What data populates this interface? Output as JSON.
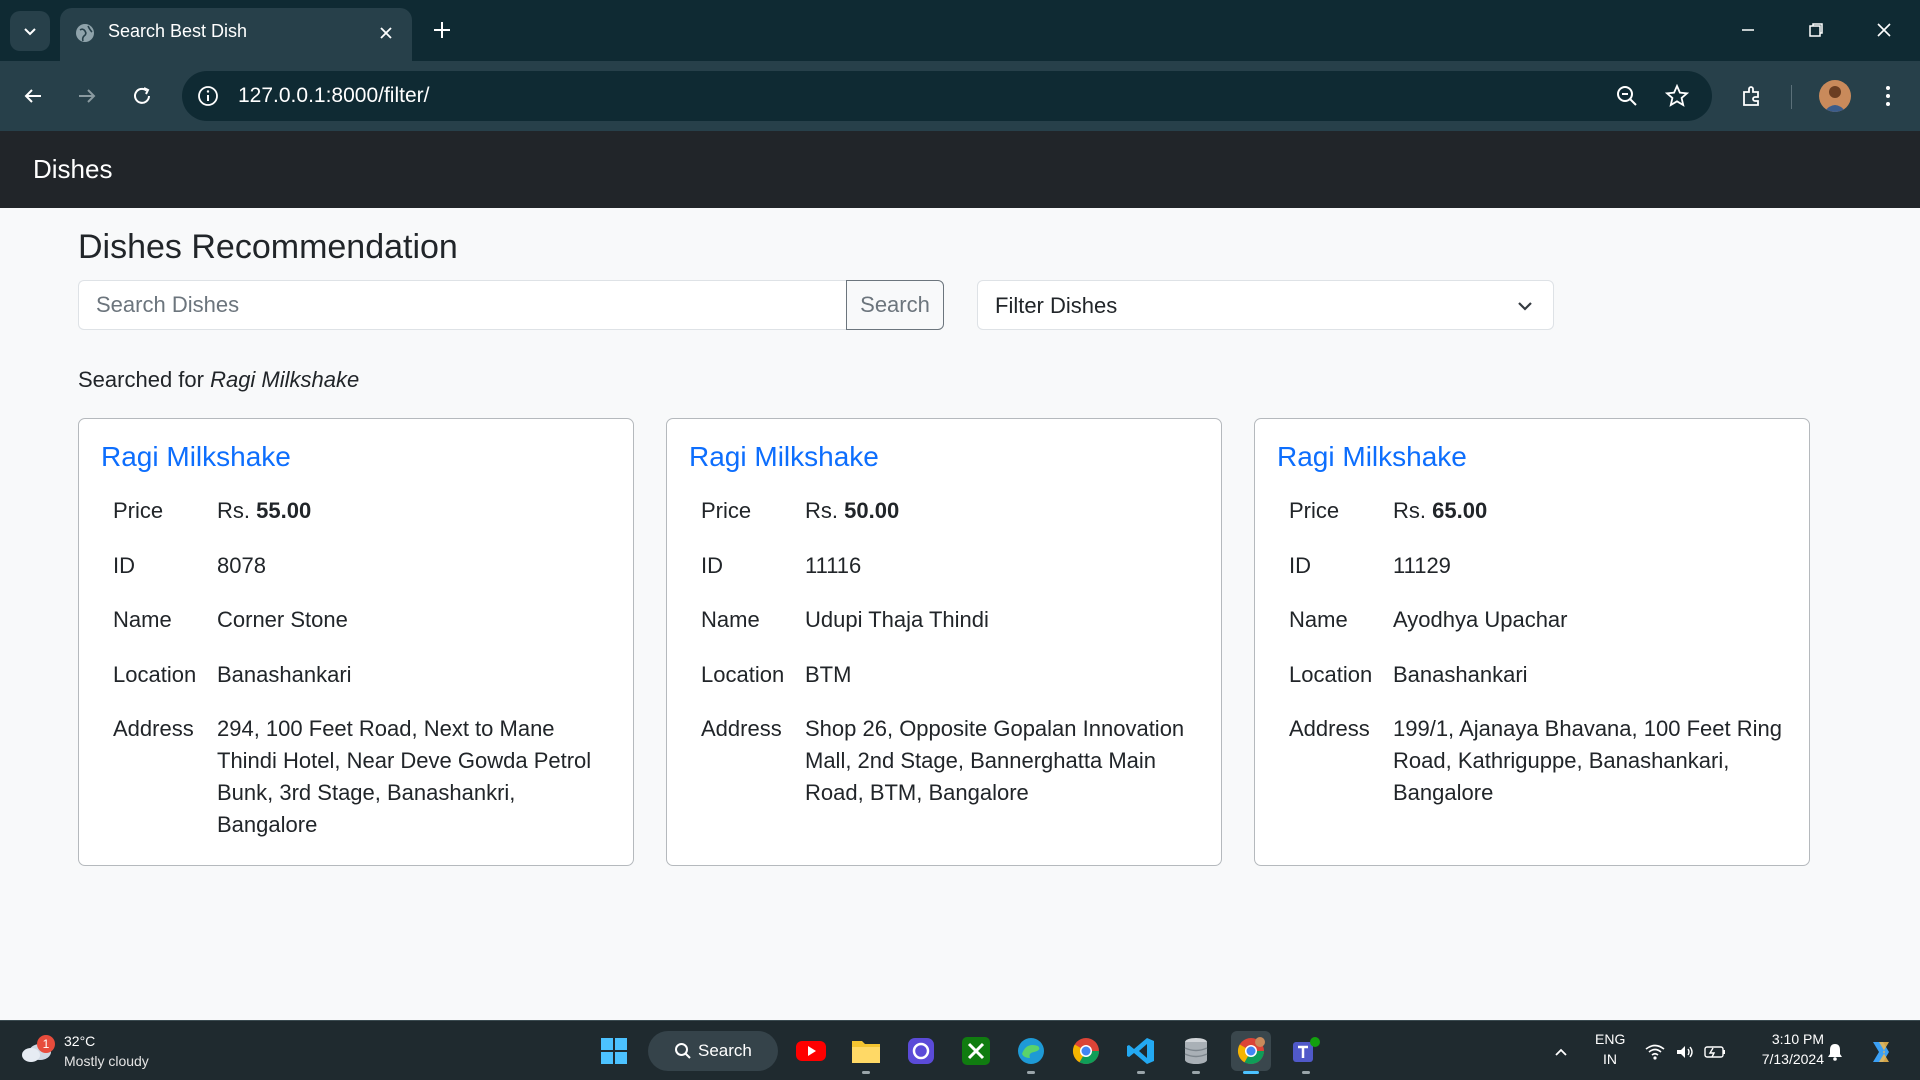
{
  "browser": {
    "tab_title": "Search Best Dish",
    "url": "127.0.0.1:8000/filter/"
  },
  "navbar": {
    "brand": "Dishes"
  },
  "main": {
    "title": "Dishes Recommendation",
    "search_placeholder": "Search Dishes",
    "search_button": "Search",
    "filter_label": "Filter Dishes",
    "searched_prefix": "Searched for ",
    "searched_term": "Ragi Milkshake"
  },
  "labels": {
    "price": "Price",
    "id": "ID",
    "name": "Name",
    "location": "Location",
    "address": "Address",
    "currency": "Rs."
  },
  "cards": [
    {
      "title": "Ragi Milkshake",
      "price": "55.00",
      "id": "8078",
      "name": "Corner Stone",
      "location": "Banashankari",
      "address": "294, 100 Feet Road, Next to Mane Thindi Hotel, Near Deve Gowda Petrol Bunk, 3rd Stage, Banashankri, Bangalore"
    },
    {
      "title": "Ragi Milkshake",
      "price": "50.00",
      "id": "11116",
      "name": "Udupi Thaja Thindi",
      "location": "BTM",
      "address": "Shop 26, Opposite Gopalan Innovation Mall, 2nd Stage, Bannerghatta Main Road, BTM, Bangalore"
    },
    {
      "title": "Ragi Milkshake",
      "price": "65.00",
      "id": "11129",
      "name": "Ayodhya Upachar",
      "location": "Banashankari",
      "address": "199/1, Ajanaya Bhavana, 100 Feet Ring Road, Kathriguppe, Banashankari, Bangalore"
    }
  ],
  "taskbar": {
    "weather_badge": "1",
    "temperature": "32°C",
    "condition": "Mostly cloudy",
    "search_label": "Search",
    "lang_top": "ENG",
    "lang_bottom": "IN",
    "time": "3:10 PM",
    "date": "7/13/2024",
    "apps": [
      "start-icon",
      "youtube-icon",
      "file-explorer-icon",
      "app-icon",
      "xbox-icon",
      "edge-icon",
      "chrome-icon",
      "vscode-icon",
      "database-icon",
      "chrome-profile-icon",
      "teams-icon"
    ]
  },
  "colors": {
    "link": "#0d6efd",
    "navbar": "#212529",
    "chrome_dark": "#0f2a33",
    "chrome_mid": "#27404a"
  }
}
